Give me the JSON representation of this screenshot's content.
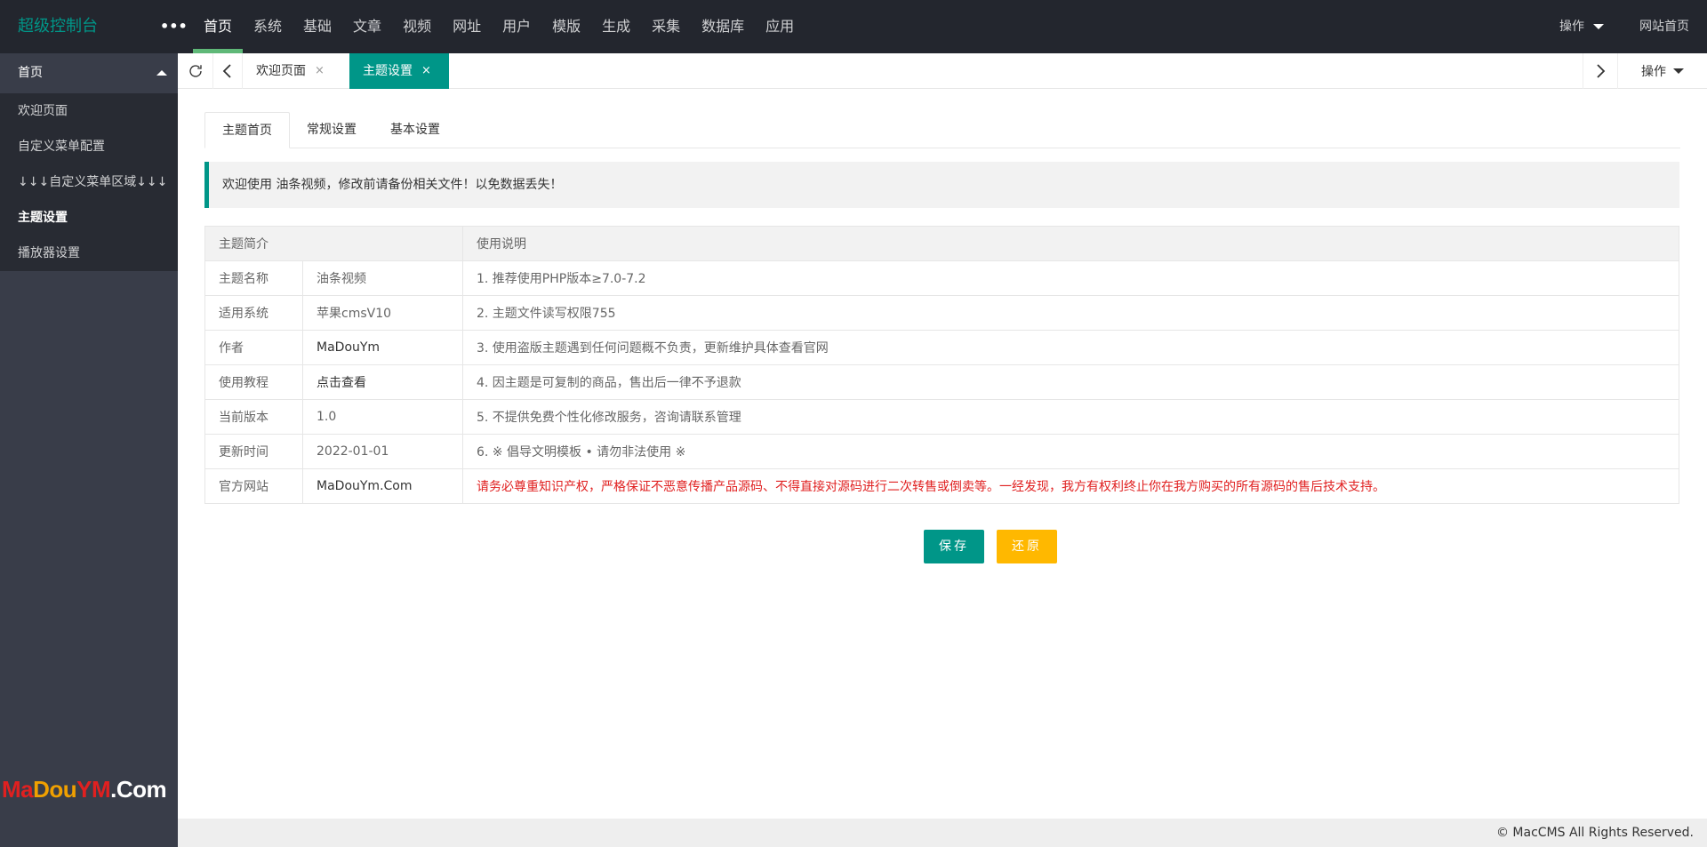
{
  "header": {
    "logo": "超级控制台",
    "more": "•••",
    "nav": [
      "首页",
      "系统",
      "基础",
      "文章",
      "视频",
      "网址",
      "用户",
      "模版",
      "生成",
      "采集",
      "数据库",
      "应用"
    ],
    "ops": "操作",
    "site_home": "网站首页"
  },
  "sidebar": {
    "group": "首页",
    "items": [
      "欢迎页面",
      "自定义菜单配置",
      "↓↓↓自定义菜单区域↓↓↓",
      "主题设置",
      "播放器设置"
    ],
    "brand": {
      "p1": "Ma",
      "p2": "Dou",
      "p3": "YM",
      "p4": ".Com"
    }
  },
  "tabbar": {
    "tabs": [
      {
        "label": "欢迎页面",
        "close": "×"
      },
      {
        "label": "主题设置",
        "close": "×"
      }
    ],
    "ops": "操作"
  },
  "content": {
    "subtabs": [
      "主题首页",
      "常规设置",
      "基本设置"
    ],
    "notice": "欢迎使用 油条视频，修改前请备份相关文件！以免数据丢失！",
    "table": {
      "head": [
        "主题简介",
        "使用说明"
      ],
      "rows": [
        {
          "k": "主题名称",
          "v": "油条视频",
          "note": "1. 推荐使用PHP版本≥7.0-7.2"
        },
        {
          "k": "适用系统",
          "v": "苹果cmsV10",
          "note": "2. 主题文件读写权限755"
        },
        {
          "k": "作者",
          "v": "MaDouYm",
          "note": "3. 使用盗版主题遇到任何问题概不负责，更新维护具体查看官网"
        },
        {
          "k": "使用教程",
          "v": "点击查看",
          "note": "4. 因主题是可复制的商品，售出后一律不予退款"
        },
        {
          "k": "当前版本",
          "v": "1.0",
          "note": "5. 不提供免费个性化修改服务，咨询请联系管理"
        },
        {
          "k": "更新时间",
          "v": "2022-01-01",
          "note": "6. ※ 倡导文明模板 • 请勿非法使用 ※"
        },
        {
          "k": "官方网站",
          "v": "MaDouYm.Com",
          "note": "请务必尊重知识产权，严格保证不恶意传播产品源码、不得直接对源码进行二次转售或倒卖等。一经发现，我方有权利终止你在我方购买的所有源码的售后技术支持。"
        }
      ]
    },
    "save": "保存",
    "reset": "还原"
  },
  "footer": "© MacCMS All Rights Reserved.",
  "colors": {
    "header_bg": "#23262e",
    "sidebar_bg": "#393d49",
    "accent": "#009688",
    "warn_btn": "#ffb800",
    "warning_text": "#e02020"
  }
}
